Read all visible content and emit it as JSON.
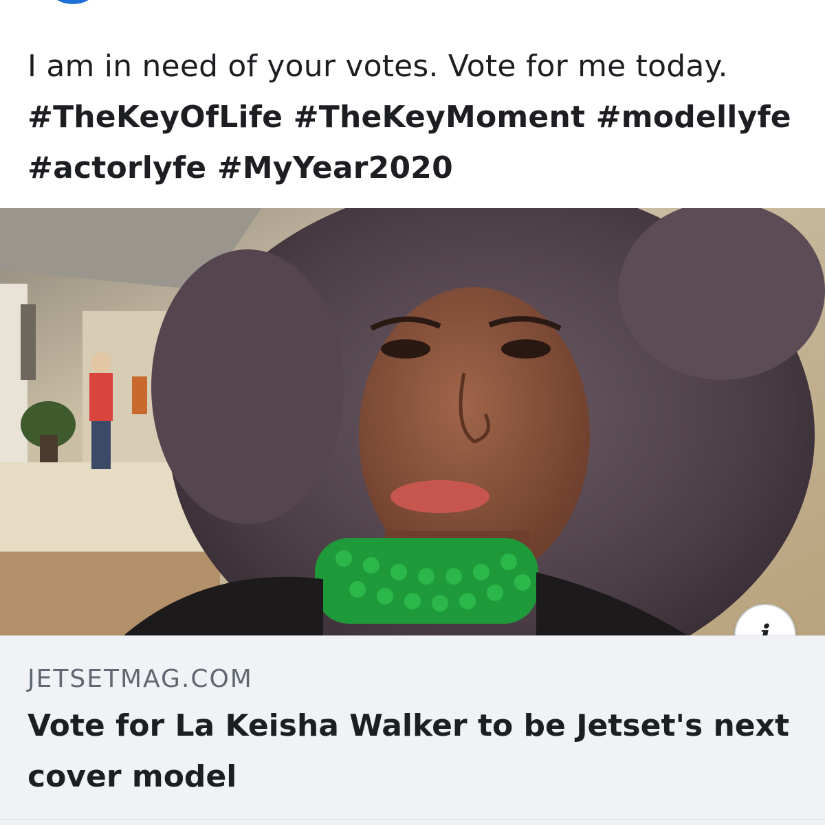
{
  "post": {
    "text": "I am in need of your votes. Vote for me today.",
    "hashtags": "#TheKeyOfLife #TheKeyMoment #modellyfe #actorlyfe #MyYear2020"
  },
  "link_preview": {
    "domain": "JETSETMAG.COM",
    "title": "Vote for La Keisha Walker to be Jetset's next cover model",
    "info_icon": "info-icon",
    "info_glyph": "i"
  },
  "colors": {
    "text": "#1c1e21",
    "meta_background": "#f0f2f5",
    "domain_text": "#606770",
    "necklace": "#1f9a3a"
  }
}
